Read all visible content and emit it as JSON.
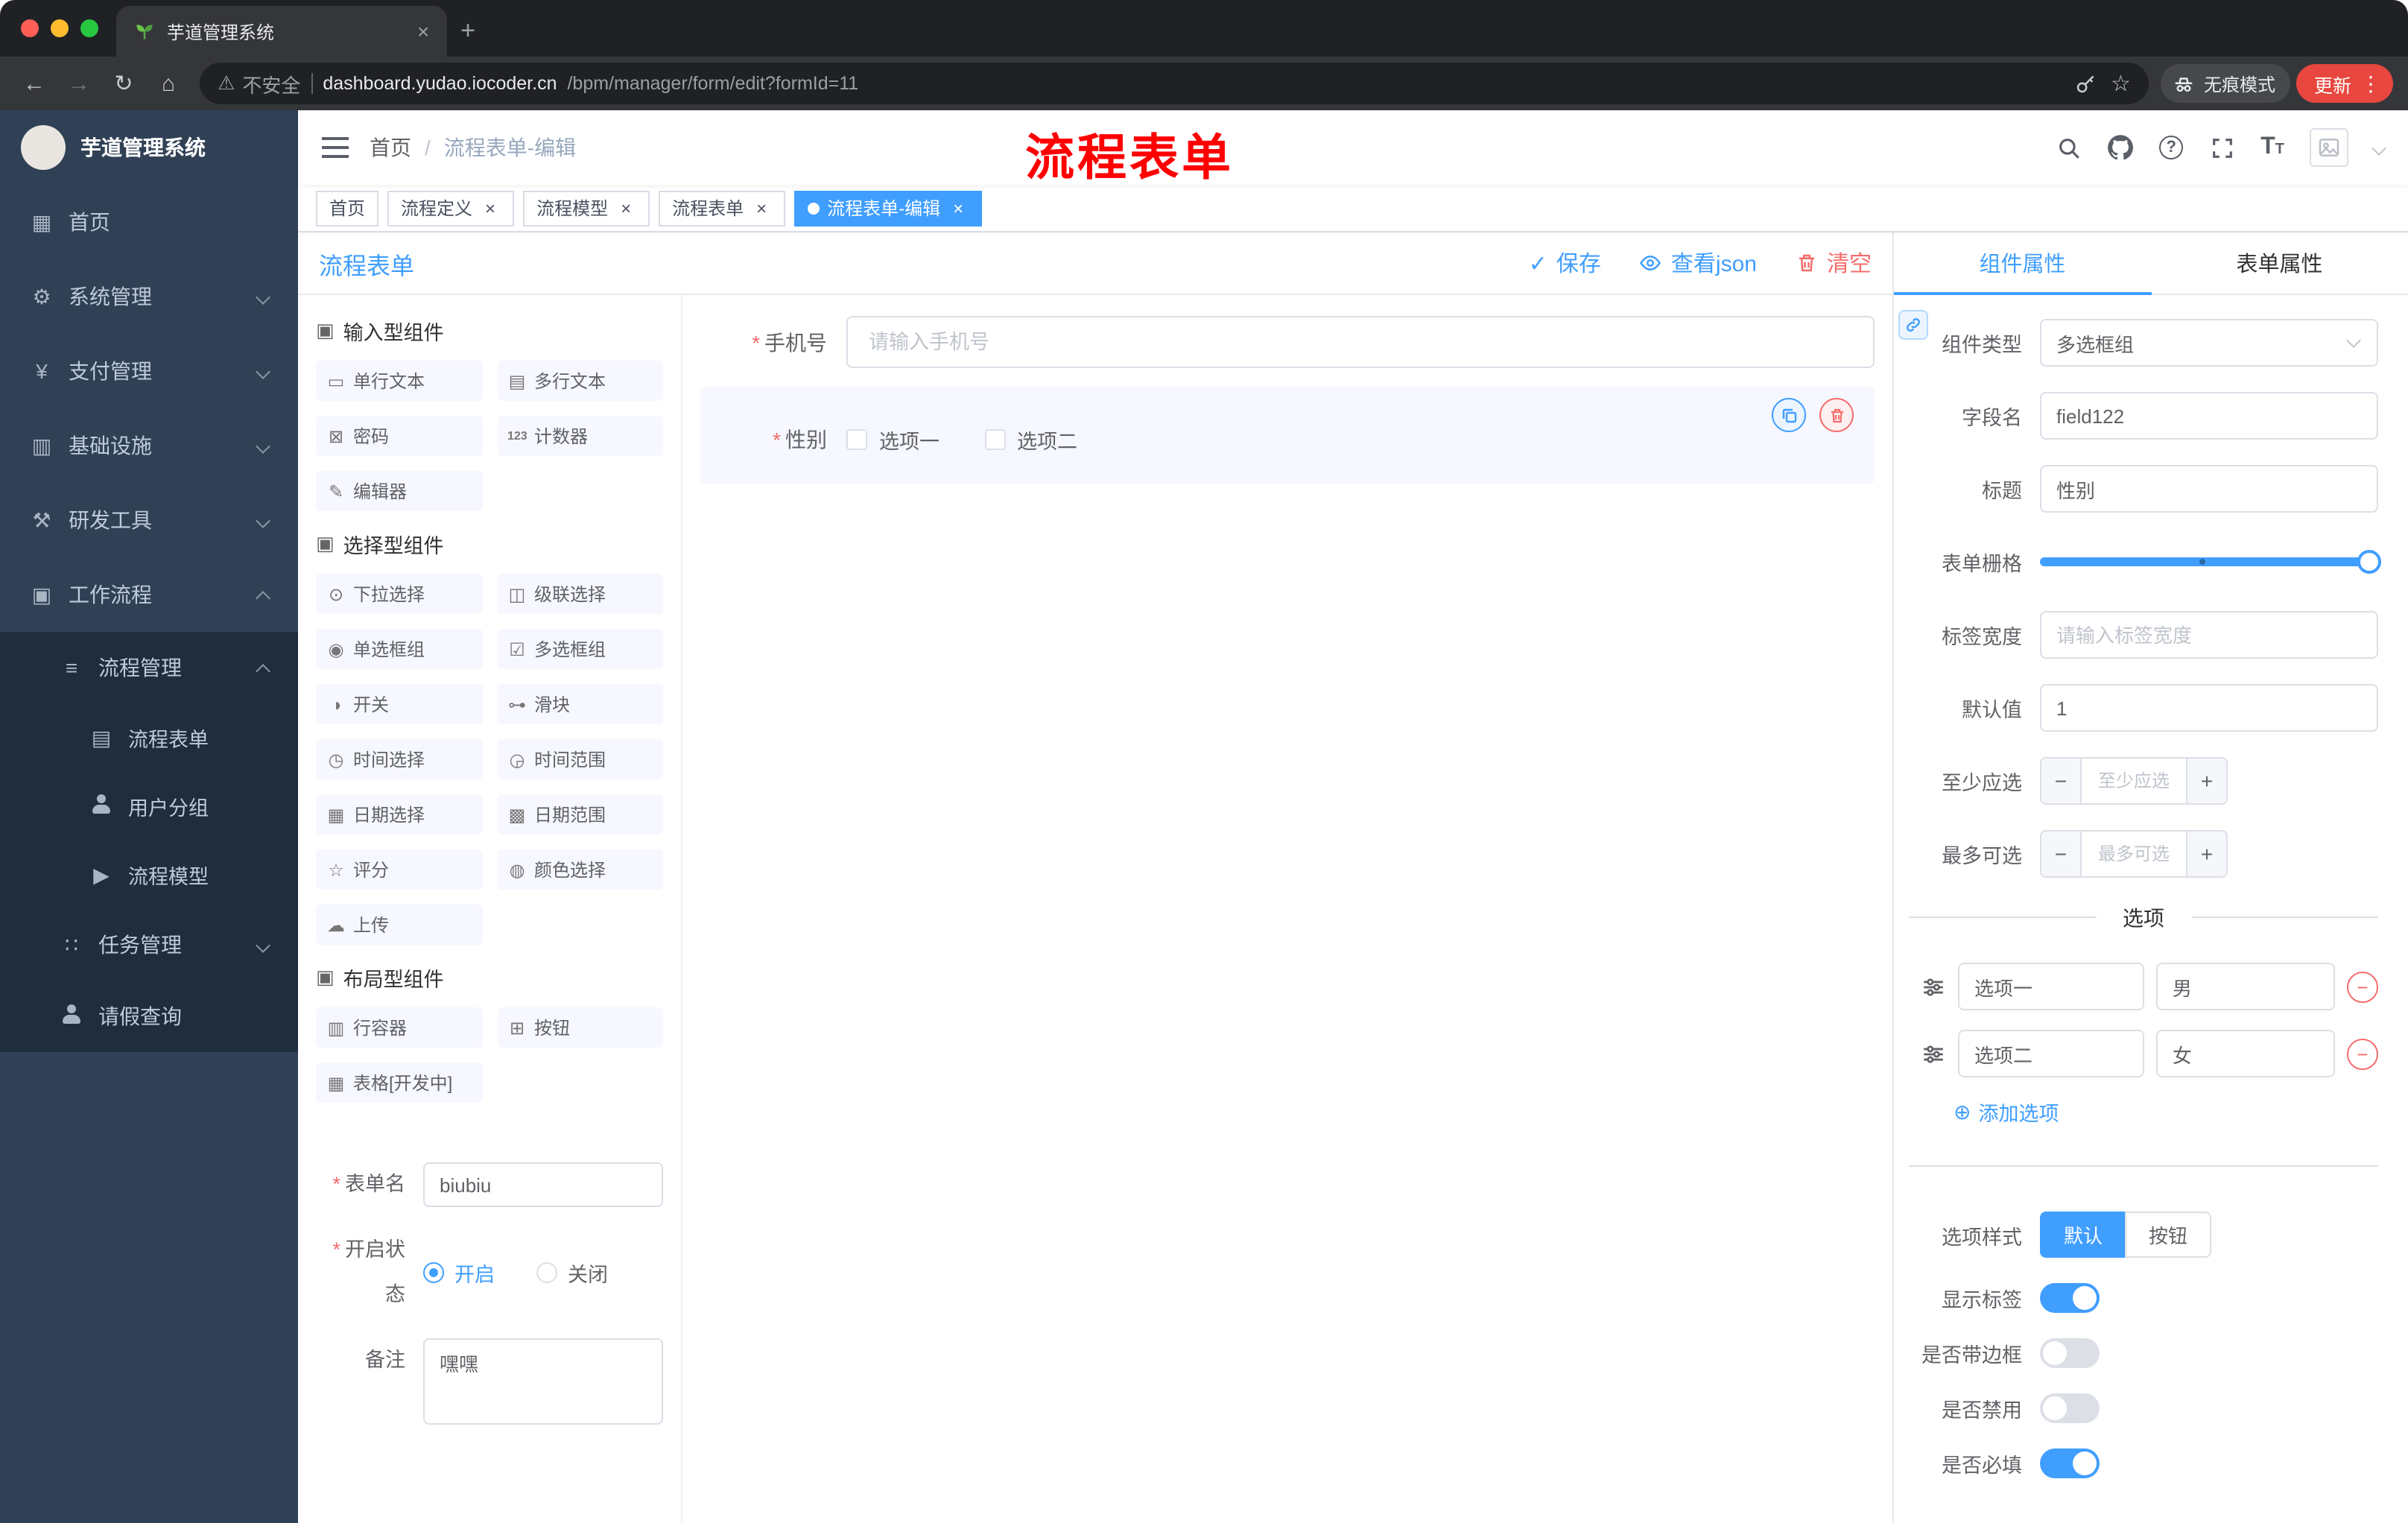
{
  "colors": {
    "primary": "#409eff",
    "danger": "#f56c6c",
    "sidebar_bg": "#304156",
    "sidebar_sub_bg": "#1f2d3d",
    "annotation_red": "#ff0000",
    "update_pill": "#e8473f"
  },
  "icons": {
    "back": "←",
    "forward": "→",
    "reload": "↻",
    "home": "⌂",
    "warning": "⚠",
    "star": "☆",
    "dots": "⋮",
    "plus": "+",
    "close": "×",
    "check": "✓",
    "dashboard": "▦",
    "gear": "⚙",
    "yen": "¥",
    "infra": "▥",
    "tools": "⚒",
    "workflow": "▣",
    "process-mgmt": "≡",
    "process-form": "▤",
    "process-model": "▶",
    "task-mgmt": "∷",
    "group": "▣",
    "ci-input": "▭",
    "ci-textarea": "▤",
    "ci-password": "⊠",
    "ci-counter": "123",
    "ci-editor": "✎",
    "ci-select": "⊙",
    "ci-cascader": "◫",
    "ci-radio": "◉",
    "ci-checkbox": "☑",
    "ci-switch": "◑",
    "ci-slider": "⊶",
    "ci-time": "◷",
    "ci-time-range": "◶",
    "ci-date": "▦",
    "ci-date-range": "▩",
    "ci-rate": "☆",
    "ci-color": "◍",
    "ci-upload": "☁",
    "ci-row": "▥",
    "ci-button": "⊞",
    "ci-table": "▦",
    "add-circle": "⊕"
  },
  "browser": {
    "tab_title": "芋道管理系统",
    "security_label": "不安全",
    "url_host": "dashboard.yudao.iocoder.cn",
    "url_path": "/bpm/manager/form/edit?formId=11",
    "incognito_label": "无痕模式",
    "update_label": "更新"
  },
  "header": {
    "breadcrumb_root": "首页",
    "breadcrumb_sep": "/",
    "breadcrumb_current": "流程表单-编辑",
    "annotation": "流程表单"
  },
  "tags": [
    {
      "label": "首页"
    },
    {
      "label": "流程定义"
    },
    {
      "label": "流程模型"
    },
    {
      "label": "流程表单"
    },
    {
      "label": "流程表单-编辑"
    }
  ],
  "sidebar": {
    "title": "芋道管理系统",
    "items": [
      {
        "label": "首页"
      },
      {
        "label": "系统管理"
      },
      {
        "label": "支付管理"
      },
      {
        "label": "基础设施"
      },
      {
        "label": "研发工具"
      },
      {
        "label": "工作流程"
      },
      {
        "label": "流程管理"
      },
      {
        "label": "流程表单"
      },
      {
        "label": "用户分组"
      },
      {
        "label": "流程模型"
      },
      {
        "label": "任务管理"
      },
      {
        "label": "请假查询"
      }
    ]
  },
  "designer": {
    "title": "流程表单",
    "save": "保存",
    "view_json": "查看json",
    "clear": "清空",
    "groups": [
      {
        "title": "输入型组件",
        "items": [
          {
            "label": "单行文本"
          },
          {
            "label": "多行文本"
          },
          {
            "label": "密码"
          },
          {
            "label": "计数器"
          },
          {
            "label": "编辑器"
          }
        ]
      },
      {
        "title": "选择型组件",
        "items": [
          {
            "label": "下拉选择"
          },
          {
            "label": "级联选择"
          },
          {
            "label": "单选框组"
          },
          {
            "label": "多选框组"
          },
          {
            "label": "开关"
          },
          {
            "label": "滑块"
          },
          {
            "label": "时间选择"
          },
          {
            "label": "时间范围"
          },
          {
            "label": "日期选择"
          },
          {
            "label": "日期范围"
          },
          {
            "label": "评分"
          },
          {
            "label": "颜色选择"
          },
          {
            "label": "上传"
          }
        ]
      },
      {
        "title": "布局型组件",
        "items": [
          {
            "label": "行容器"
          },
          {
            "label": "按钮"
          },
          {
            "label": "表格[开发中]"
          }
        ]
      }
    ],
    "meta": {
      "name_label": "表单名",
      "name_value": "biubiu",
      "status_label": "开启状态",
      "status_on": "开启",
      "status_off": "关闭",
      "remark_label": "备注",
      "remark_value": "嘿嘿"
    },
    "canvas": {
      "phone_label": "手机号",
      "phone_placeholder": "请输入手机号",
      "gender_label": "性别",
      "gender_options": [
        {
          "label": "选项一"
        },
        {
          "label": "选项二"
        }
      ]
    }
  },
  "props": {
    "tab_component": "组件属性",
    "tab_form": "表单属性",
    "rows": {
      "type_label": "组件类型",
      "type_value": "多选框组",
      "field_label": "字段名",
      "field_value": "field122",
      "title_label": "标题",
      "title_value": "性别",
      "grid_label": "表单栅格",
      "label_width_label": "标签宽度",
      "label_width_placeholder": "请输入标签宽度",
      "default_label": "默认值",
      "default_value": "1",
      "min_label": "至少应选",
      "min_placeholder": "至少应选",
      "max_label": "最多可选",
      "max_placeholder": "最多可选"
    },
    "options": {
      "divider": "选项",
      "rows": [
        {
          "name": "选项一",
          "value": "男"
        },
        {
          "name": "选项二",
          "value": "女"
        }
      ],
      "add": "添加选项"
    },
    "style": {
      "label": "选项样式",
      "default": "默认",
      "button": "按钮",
      "selected": "默认"
    },
    "switches": [
      {
        "label": "显示标签",
        "on": true
      },
      {
        "label": "是否带边框",
        "on": false
      },
      {
        "label": "是否禁用",
        "on": false
      },
      {
        "label": "是否必填",
        "on": true
      }
    ]
  }
}
